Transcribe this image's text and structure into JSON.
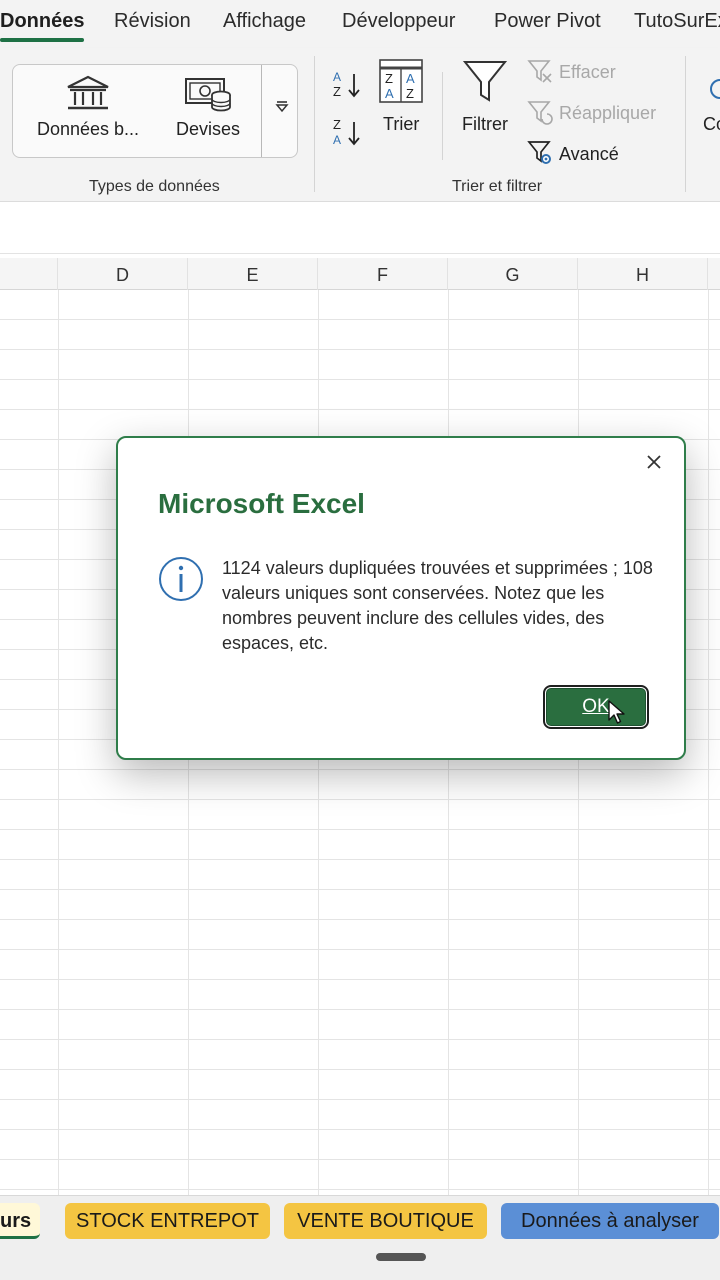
{
  "ribbon_tabs": [
    "Données",
    "Révision",
    "Affichage",
    "Développeur",
    "Power Pivot",
    "TutoSurEx"
  ],
  "ribbon": {
    "data_types": {
      "items": [
        {
          "label": "Données b...",
          "icon": "bank-icon"
        },
        {
          "label": "Devises",
          "icon": "currency-icon"
        }
      ],
      "group_label": "Types de données"
    },
    "sort_filter": {
      "sort_label": "Trier",
      "filter_label": "Filtrer",
      "clear_label": "Effacer",
      "reapply_label": "Réappliquer",
      "advanced_label": "Avancé",
      "group_label": "Trier et filtrer"
    },
    "next_group_partial": "Co"
  },
  "columns": [
    "D",
    "E",
    "F",
    "G",
    "H"
  ],
  "dialog": {
    "title": "Microsoft Excel",
    "message": "1124 valeurs dupliquées trouvées et supprimées ; 108 valeurs uniques sont conservées. Notez que les nombres peuvent inclure des cellules vides, des espaces, etc.",
    "ok_label": "OK"
  },
  "sheet_tabs": [
    {
      "label": "eurs",
      "color": "#f4c542"
    },
    {
      "label": "STOCK ENTREPOT",
      "color": "#f4c542"
    },
    {
      "label": "VENTE BOUTIQUE",
      "color": "#f4c542"
    },
    {
      "label": "Données à analyser",
      "color": "#5b8fd6"
    }
  ],
  "colors": {
    "accent": "#1e7145",
    "dialog_title": "#2a6e3f",
    "info_icon": "#2f6fb0"
  }
}
